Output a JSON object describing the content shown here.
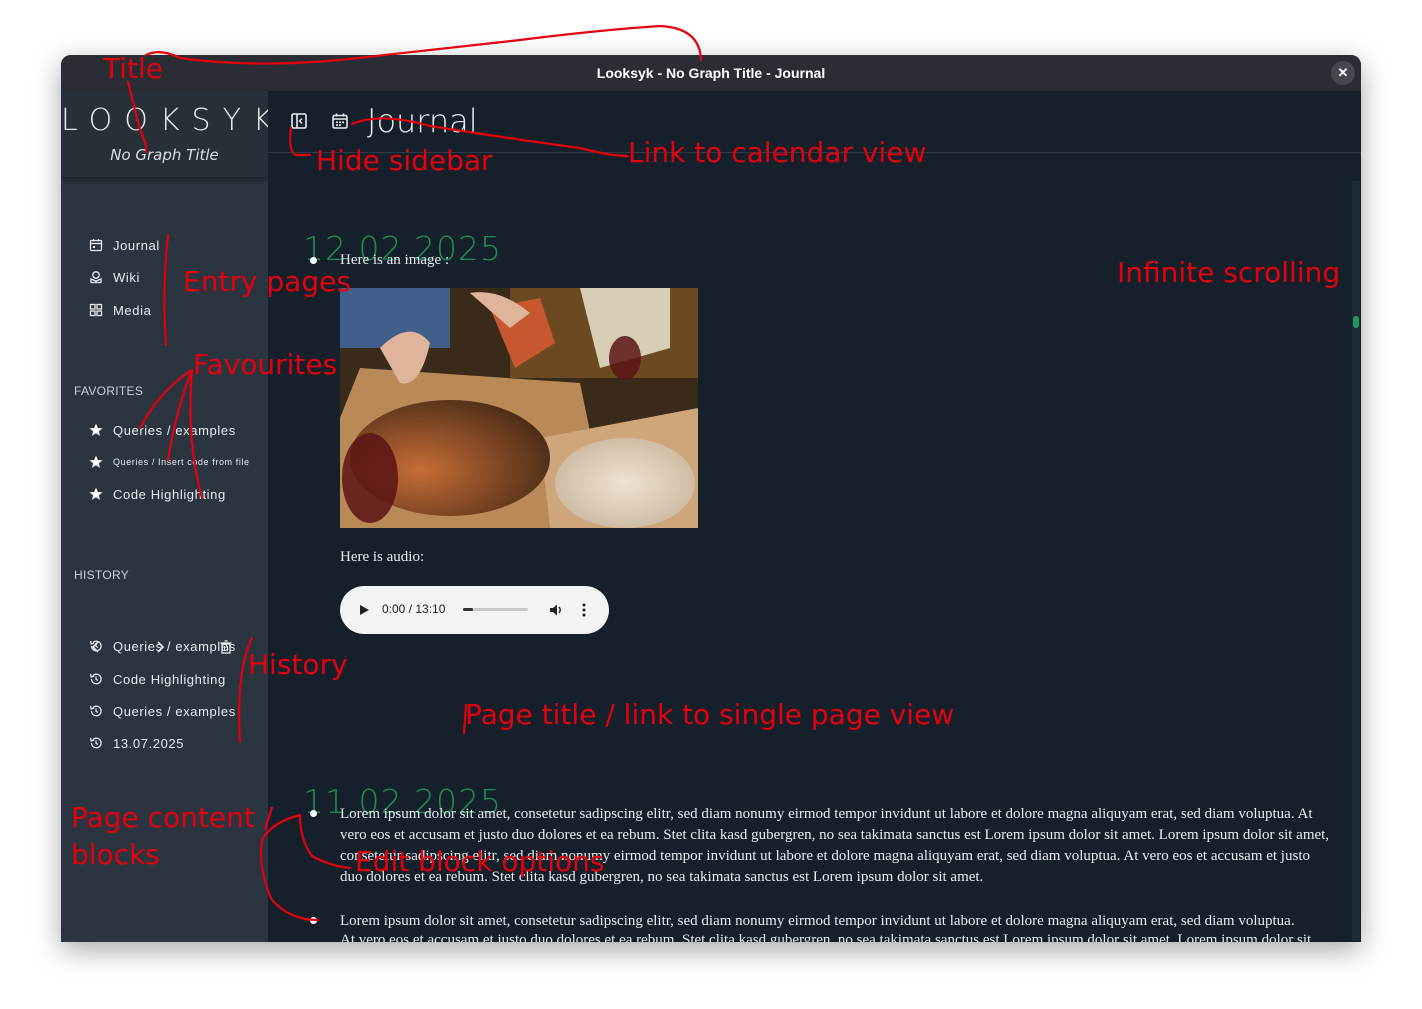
{
  "window": {
    "title": "Looksyk - No Graph Title - Journal"
  },
  "sidebar": {
    "brand": "LOOKSYK",
    "graph_title": "No Graph Title",
    "entry_pages": [
      {
        "label": "Journal",
        "icon": "calendar-icon"
      },
      {
        "label": "Wiki",
        "icon": "wiki-icon"
      },
      {
        "label": "Media",
        "icon": "grid-icon"
      }
    ],
    "favorites_title": "FAVORITES",
    "favorites": [
      {
        "label": "Queries / examples",
        "icon": "star-icon"
      },
      {
        "label": "Queries / Insert code from file",
        "icon": "star-icon"
      },
      {
        "label": "Code Highlighting",
        "icon": "star-icon"
      }
    ],
    "history_title": "HISTORY",
    "history": [
      {
        "label": "Queries / examples",
        "icon": "history-icon"
      },
      {
        "label": "Code Highlighting",
        "icon": "history-icon"
      },
      {
        "label": "Queries / examples",
        "icon": "history-icon"
      },
      {
        "label": "13.07.2025",
        "icon": "history-icon"
      }
    ]
  },
  "main": {
    "page_title": "Journal",
    "days": [
      {
        "date": "12.02.2025",
        "blocks": [
          {
            "text": "Here is an image :"
          },
          {
            "text": "Here is audio:"
          }
        ]
      },
      {
        "date": "11.02.2025",
        "blocks": [
          {
            "text": "Lorem ipsum dolor sit amet, consetetur sadipscing elitr, sed diam nonumy eirmod tempor invidunt ut labore et dolore magna aliquyam erat, sed diam voluptua. At vero eos et accusam et justo duo dolores et ea rebum. Stet clita kasd gubergren, no sea takimata sanctus est Lorem ipsum dolor sit amet. Lorem ipsum dolor sit amet, consetetur sadipscing elitr, sed diam nonumy eirmod tempor invidunt ut labore et dolore magna aliquyam erat, sed diam voluptua. At vero eos et accusam et justo duo dolores et ea rebum. Stet clita kasd gubergren, no sea takimata sanctus est Lorem ipsum dolor sit amet."
          },
          {
            "text": "Lorem ipsum dolor sit amet, consetetur sadipscing elitr, sed diam nonumy eirmod tempor invidunt ut labore et dolore magna aliquyam erat, sed diam voluptua."
          },
          {
            "text": "At vero eos et accusam et justo duo dolores et ea rebum. Stet clita kasd gubergren, no sea takimata sanctus est Lorem ipsum dolor sit amet. Lorem ipsum dolor sit"
          }
        ]
      }
    ],
    "audio": {
      "time": "0:00 / 13:10",
      "progress": 0.15
    }
  },
  "annotations": {
    "title": "Title",
    "hide_sidebar": "Hide sidebar",
    "calendar_link": "Link to calendar view",
    "entry_pages": "Entry pages",
    "favourites": "Favourites",
    "history": "History",
    "infinite_scrolling": "Infinite scrolling",
    "page_title_link": "Page title / link to single page view",
    "page_content": "Page content /",
    "blocks": "blocks",
    "edit_block": "Edit block options"
  },
  "colors": {
    "accent_green": "#1f8a57",
    "annotation_red": "#e3000f",
    "sidebar_bg": "#2b3540",
    "main_bg": "#16202b"
  }
}
